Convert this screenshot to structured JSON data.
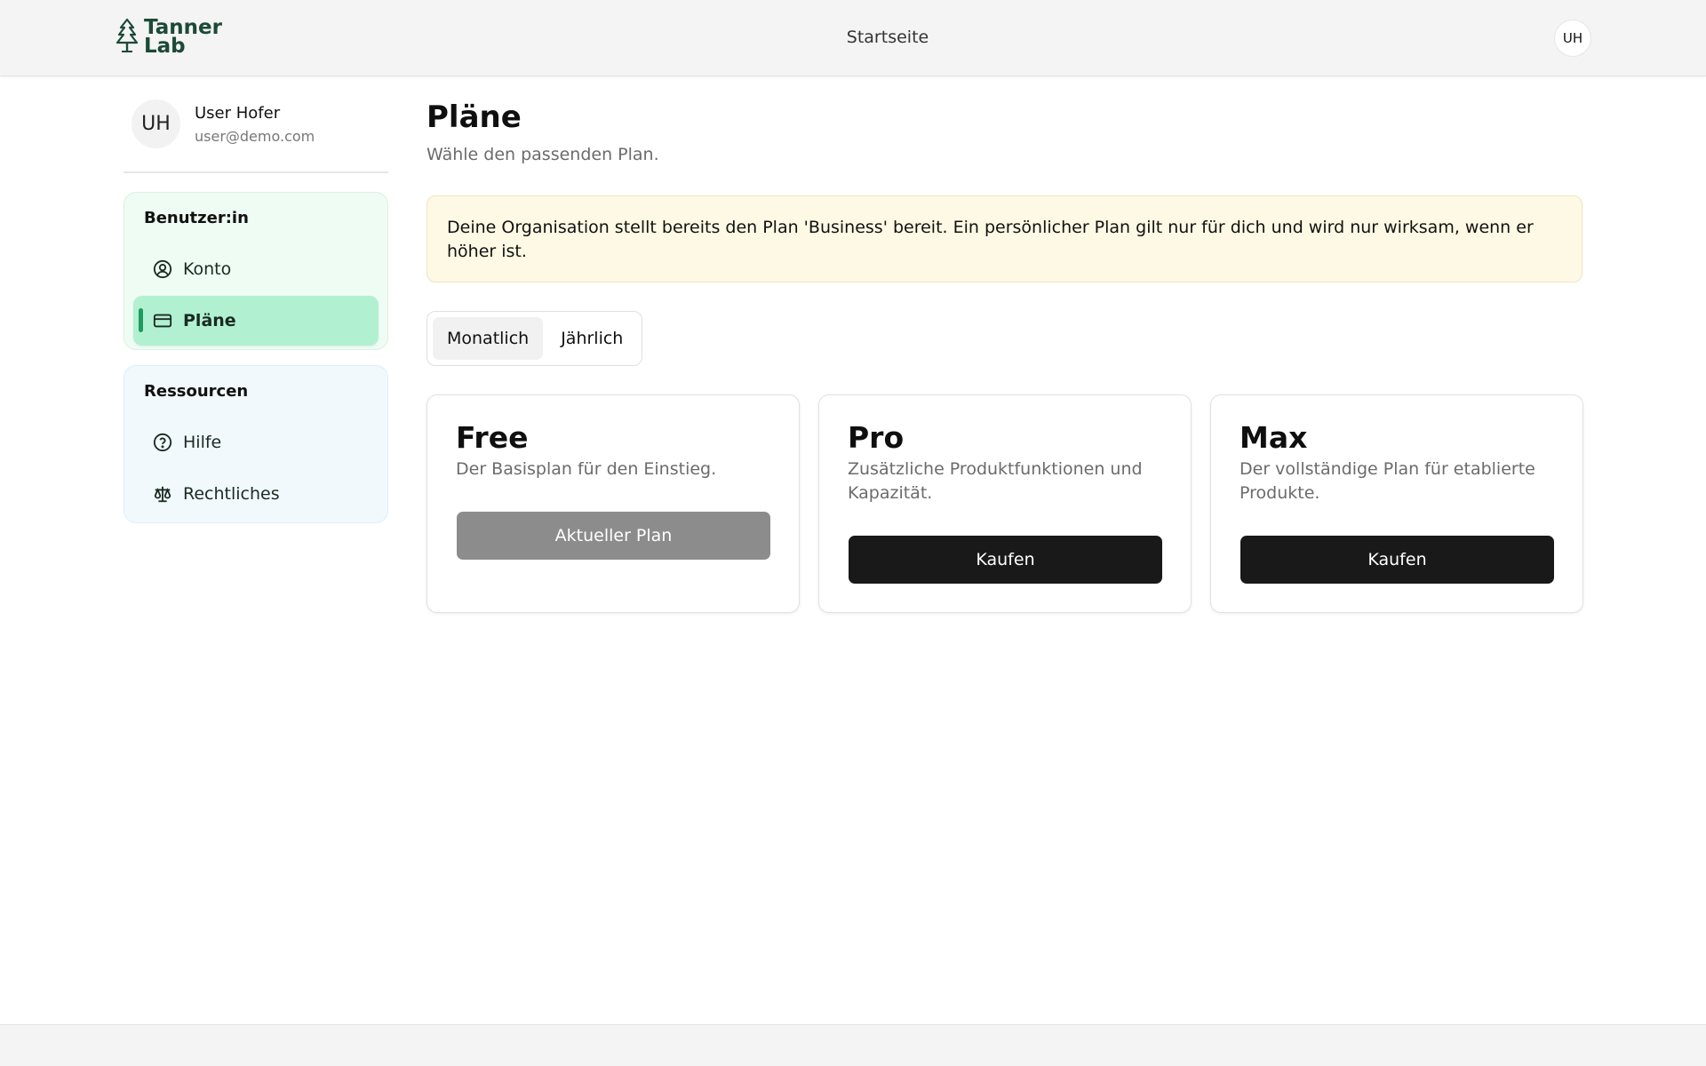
{
  "header": {
    "logo_text_line1": "Tanner",
    "logo_text_line2": "Lab",
    "nav_link": "Startseite",
    "avatar_initials": "UH"
  },
  "sidebar": {
    "user": {
      "initials": "UH",
      "name": "User Hofer",
      "email": "user@demo.com"
    },
    "groups": [
      {
        "title": "Benutzer:in",
        "items": [
          {
            "label": "Konto",
            "icon": "user-circle-icon",
            "active": false
          },
          {
            "label": "Pläne",
            "icon": "credit-card-icon",
            "active": true
          }
        ]
      },
      {
        "title": "Ressourcen",
        "items": [
          {
            "label": "Hilfe",
            "icon": "help-circle-icon",
            "active": false
          },
          {
            "label": "Rechtliches",
            "icon": "scale-icon",
            "active": false
          }
        ]
      }
    ]
  },
  "main": {
    "title": "Pläne",
    "subtitle": "Wähle den passenden Plan.",
    "notice": "Deine Organisation stellt bereits den Plan 'Business' bereit. Ein persönlicher Plan gilt nur für dich und wird nur wirksam, wenn er höher ist.",
    "billing_toggle": {
      "options": [
        "Monatlich",
        "Jährlich"
      ],
      "selected": "Monatlich"
    },
    "plans": [
      {
        "name": "Free",
        "description": "Der Basisplan für den Einstieg.",
        "button": "Aktueller Plan",
        "current": true
      },
      {
        "name": "Pro",
        "description": "Zusätzliche Produktfunktionen und Kapazität.",
        "button": "Kaufen",
        "current": false
      },
      {
        "name": "Max",
        "description": "Der vollständige Plan für etablierte Produkte.",
        "button": "Kaufen",
        "current": false
      }
    ]
  },
  "colors": {
    "brand": "#1c4a37",
    "active_nav_bg": "#b1f1d2",
    "active_indicator": "#1f9b5f",
    "notice_bg": "#fef9e4",
    "buy_button": "#19191a",
    "current_button": "#8c8c8c"
  }
}
